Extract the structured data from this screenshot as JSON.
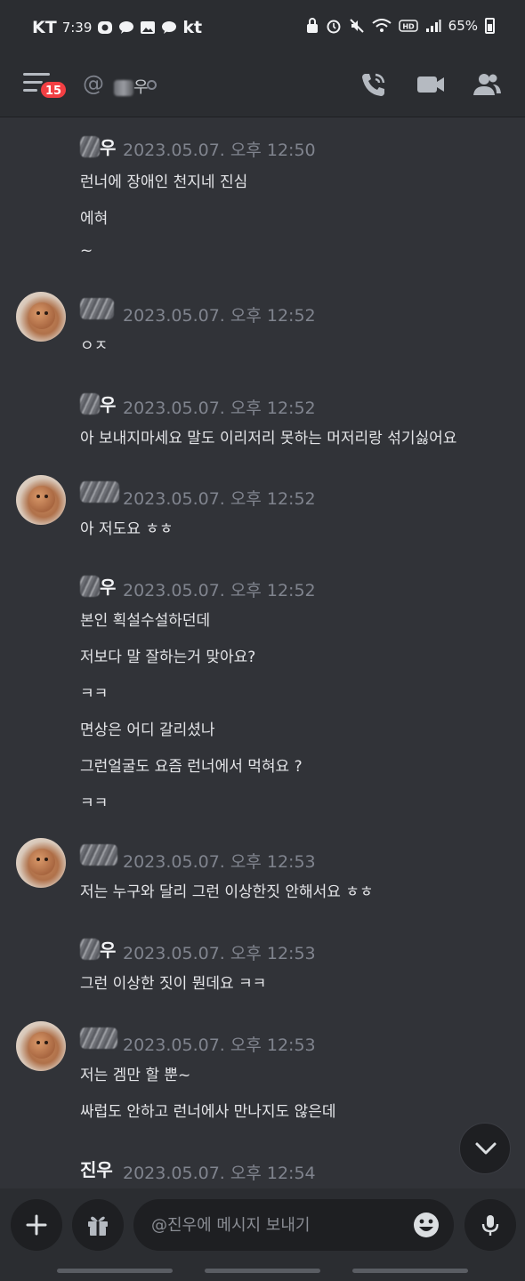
{
  "status_bar": {
    "carrier": "KT",
    "time": "7:39",
    "carrier2": "kt",
    "battery": "65%"
  },
  "header": {
    "unread_count": "15",
    "dm_prefix": "@",
    "dm_name_suffix": "우"
  },
  "messages": [
    {
      "author_suffix": "우",
      "timestamp": "2023.05.07. 오후 12:50",
      "lines": [
        "런너에 장애인 천지네 진심",
        "에혀",
        "~"
      ]
    },
    {
      "author_suffix": "",
      "timestamp": "2023.05.07. 오후 12:52",
      "lines": [
        "ㅇㅈ"
      ]
    },
    {
      "author_suffix": "우",
      "timestamp": "2023.05.07. 오후 12:52",
      "lines": [
        "아 보내지마세요 말도 이리저리 못하는 머저리랑 섞기싫어요"
      ]
    },
    {
      "author_suffix": "",
      "timestamp": "2023.05.07. 오후 12:52",
      "lines": [
        "아 저도요 ㅎㅎ"
      ]
    },
    {
      "author_suffix": "우",
      "timestamp": "2023.05.07. 오후 12:52",
      "lines": [
        "본인 획설수설하던데",
        "저보다 말 잘하는거 맞아요?",
        "ㅋㅋ",
        "면상은 어디 갈리셨나",
        "그런얼굴도 요즘 런너에서 먹혀요 ?",
        "ㅋㅋ"
      ]
    },
    {
      "author_suffix": "",
      "timestamp": "2023.05.07. 오후 12:53",
      "lines": [
        "저는 누구와 달리 그런 이상한짓 안해서요 ㅎㅎ"
      ]
    },
    {
      "author_suffix": "우",
      "timestamp": "2023.05.07. 오후 12:53",
      "lines": [
        "그런 이상한 짓이 뭔데요 ㅋㅋ"
      ]
    },
    {
      "author_suffix": "",
      "timestamp": "2023.05.07. 오후 12:53",
      "lines": [
        "저는 겜만 할 뿐~",
        "싸럽도 안하고 런너에사 만나지도 않은데"
      ]
    },
    {
      "author_name": "진우",
      "timestamp": "2023.05.07. 오후 12:54",
      "lines": []
    }
  ],
  "composer": {
    "placeholder": "@진우에 메시지 보내기"
  }
}
